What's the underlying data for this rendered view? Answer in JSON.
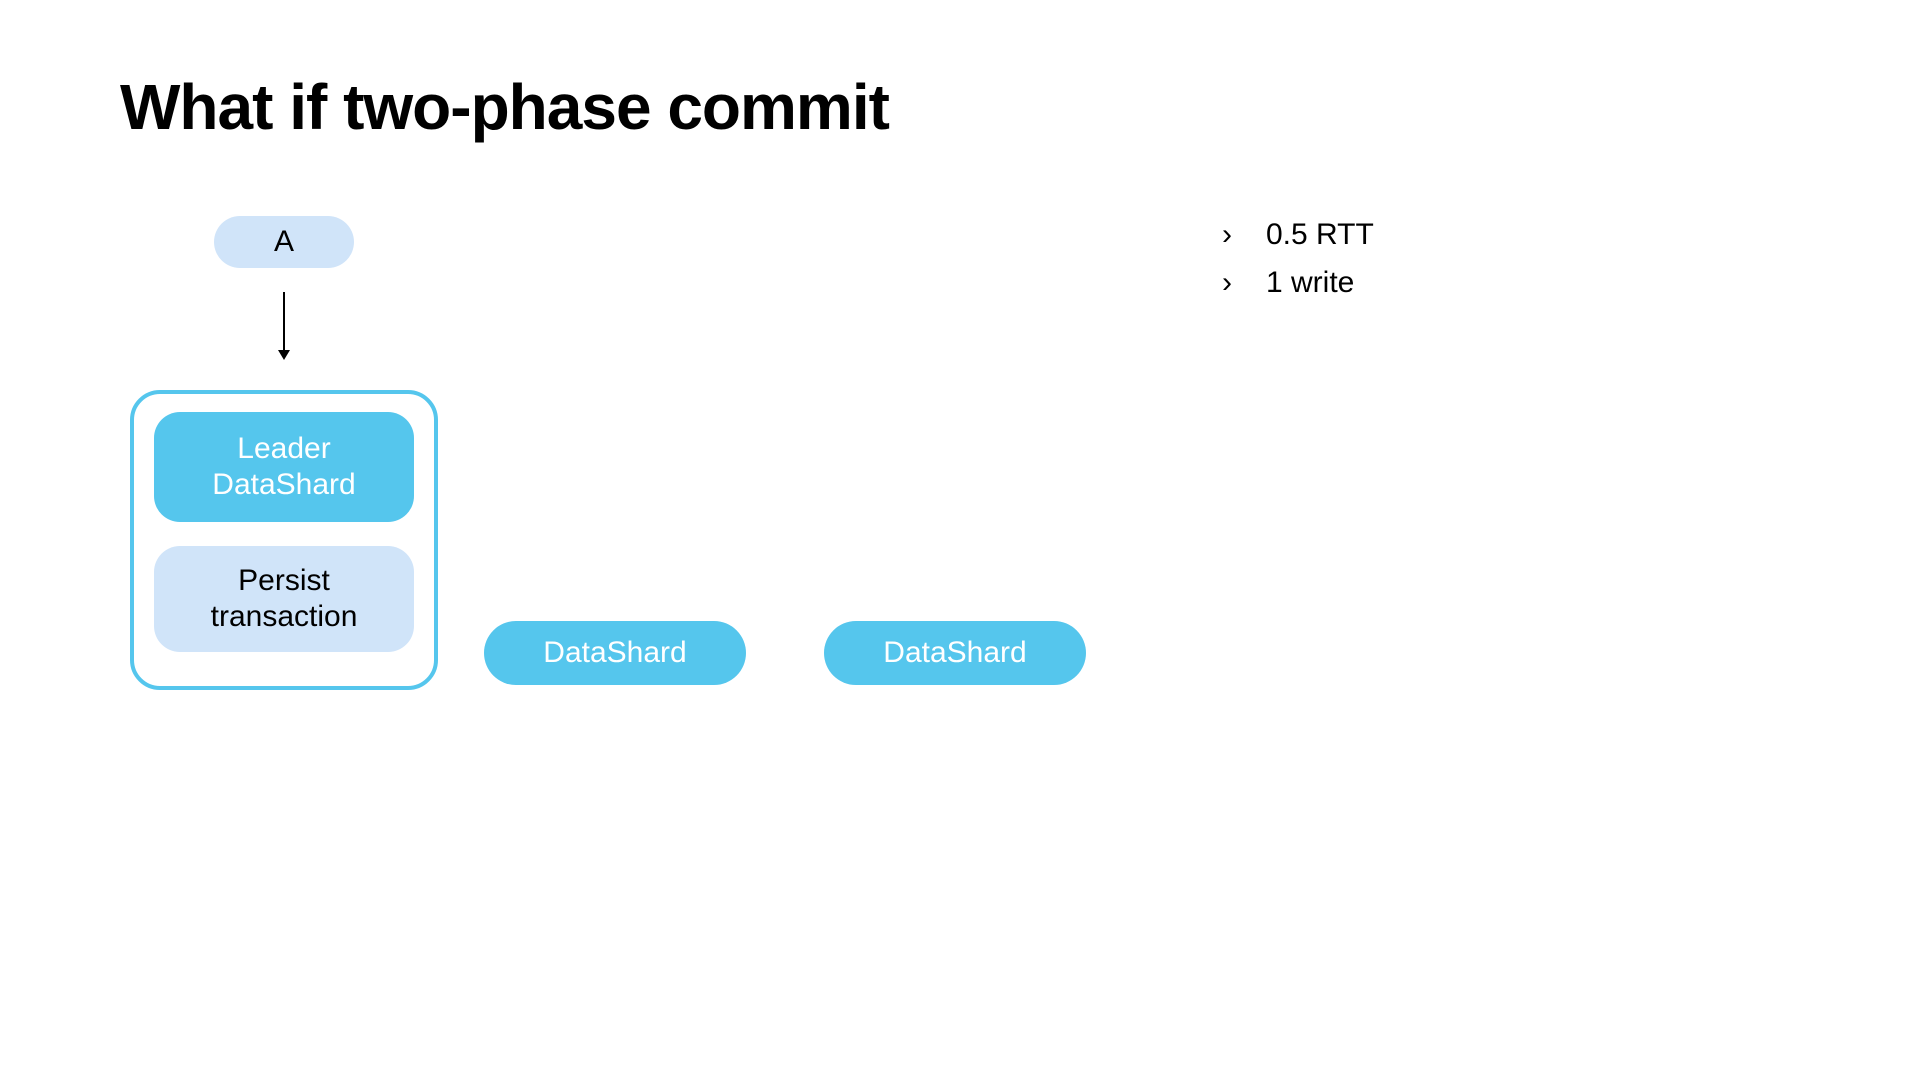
{
  "title": "What if two-phase commit",
  "diagram": {
    "node_a": "A",
    "leader_box": {
      "leader_line1": "Leader",
      "leader_line2": "DataShard",
      "persist_line1": "Persist",
      "persist_line2": "transaction"
    },
    "shard2": "DataShard",
    "shard3": "DataShard"
  },
  "bullets": [
    "0.5 RTT",
    "1 write"
  ]
}
